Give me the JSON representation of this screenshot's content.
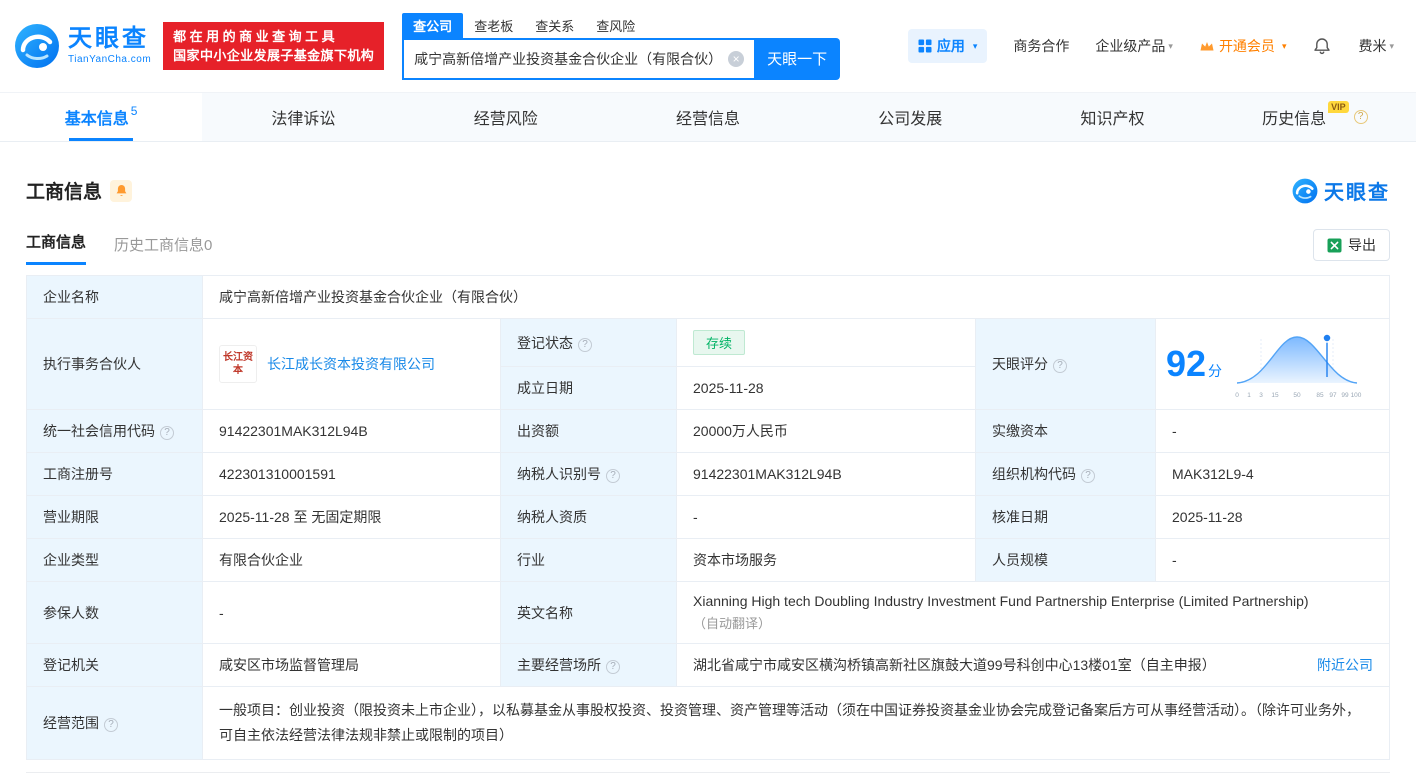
{
  "colors": {
    "accent": "#0b84ff",
    "brand_red": "#e62129",
    "status_green": "#00b365",
    "vip_orange": "#ff8000",
    "label_bg": "#ebf6fe"
  },
  "icons": {
    "help": "?",
    "clear": "×",
    "caret": "▾"
  },
  "header": {
    "logo": {
      "brand": "天眼查",
      "domain": "TianYanCha.com"
    },
    "slogan_line1": "都在用的商业查询工具",
    "slogan_line2": "国家中小企业发展子基金旗下机构",
    "search": {
      "tabs": [
        {
          "label": "查公司",
          "active": true
        },
        {
          "label": "查老板",
          "active": false
        },
        {
          "label": "查关系",
          "active": false
        },
        {
          "label": "查风险",
          "active": false
        }
      ],
      "value": "咸宁高新倍增产业投资基金合伙企业（有限合伙）",
      "button": "天眼一下"
    },
    "menu": {
      "apps": "应用",
      "cooperation": "商务合作",
      "enterprise": "企业级产品",
      "vip": "开通会员",
      "user": "费米"
    }
  },
  "nav": {
    "tabs": [
      {
        "label": "基本信息",
        "badge": "5",
        "active": true
      },
      {
        "label": "法律诉讼"
      },
      {
        "label": "经营风险"
      },
      {
        "label": "经营信息"
      },
      {
        "label": "公司发展"
      },
      {
        "label": "知识产权"
      },
      {
        "label": "历史信息",
        "vip": "VIP"
      }
    ]
  },
  "section": {
    "title": "工商信息",
    "watermark": "天眼查",
    "export": "导出",
    "subtabs": [
      {
        "label": "工商信息",
        "active": true
      },
      {
        "label": "历史工商信息",
        "count": "0"
      }
    ]
  },
  "info": {
    "name_label": "企业名称",
    "name": "咸宁高新倍增产业投资基金合伙企业（有限合伙）",
    "partner_label": "执行事务合伙人",
    "partner_logo_text": "长江资本",
    "partner_name": "长江成长资本投资有限公司",
    "reg_status_label": "登记状态",
    "reg_status": "存续",
    "establish_label": "成立日期",
    "establish_date": "2025-11-28",
    "score_label": "天眼评分",
    "score": "92",
    "score_unit": "分",
    "uscc_label": "统一社会信用代码",
    "uscc": "91422301MAK312L94B",
    "capital_label": "出资额",
    "capital": "20000万人民币",
    "paid_label": "实缴资本",
    "paid": "-",
    "regno_label": "工商注册号",
    "regno": "422301310001591",
    "taxno_label": "纳税人识别号",
    "taxno": "91422301MAK312L94B",
    "orgcode_label": "组织机构代码",
    "orgcode": "MAK312L9-4",
    "term_label": "营业期限",
    "term": "2025-11-28 至 无固定期限",
    "taxqual_label": "纳税人资质",
    "taxqual": "-",
    "approve_label": "核准日期",
    "approve_date": "2025-11-28",
    "type_label": "企业类型",
    "type": "有限合伙企业",
    "industry_label": "行业",
    "industry": "资本市场服务",
    "staff_label": "人员规模",
    "staff": "-",
    "insured_label": "参保人数",
    "insured": "-",
    "en_name_label": "英文名称",
    "en_name": "Xianning High tech Doubling Industry Investment Fund Partnership Enterprise (Limited Partnership)",
    "en_name_note": "（自动翻译）",
    "authority_label": "登记机关",
    "authority": "咸安区市场监督管理局",
    "address_label": "主要经营场所",
    "address": "湖北省咸宁市咸安区横沟桥镇高新社区旗鼓大道99号科创中心13楼01室（自主申报）",
    "nearby": "附近公司",
    "scope_label": "经营范围",
    "scope": "一般项目：创业投资（限投资未上市企业），以私募基金从事股权投资、投资管理、资产管理等活动（须在中国证券投资基金业协会完成登记备案后方可从事经营活动）。（除许可业务外，可自主依法经营法律法规非禁止或限制的项目）"
  },
  "score_chart": {
    "type": "area",
    "description": "score distribution bell curve with marker at company score",
    "score": 92,
    "axis": [
      "0",
      "1",
      "3",
      "15",
      "50",
      "85",
      "97",
      "99",
      "100"
    ]
  }
}
